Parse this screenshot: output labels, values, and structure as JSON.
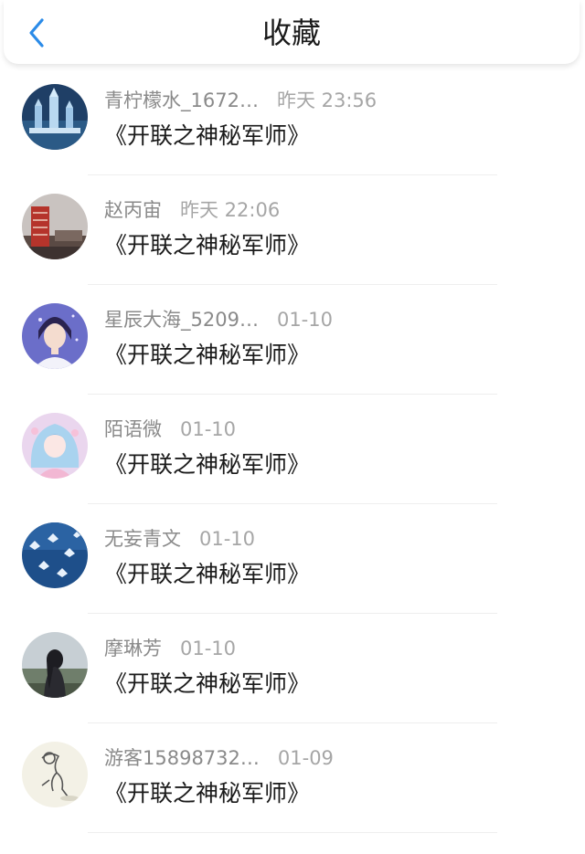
{
  "header": {
    "title": "收藏"
  },
  "items": [
    {
      "user": "青柠檬水_1672…",
      "time": "昨天 23:56",
      "book": "《开联之神秘军师》",
      "avatar": "castle-night-avatar"
    },
    {
      "user": "赵丙宙",
      "time": "昨天 22:06",
      "book": "《开联之神秘军师》",
      "avatar": "tower-avatar"
    },
    {
      "user": "星辰大海_5209…",
      "time": "01-10",
      "book": "《开联之神秘军师》",
      "avatar": "anime-boy-avatar"
    },
    {
      "user": "陌语微",
      "time": "01-10",
      "book": "《开联之神秘军师》",
      "avatar": "anime-girl-avatar"
    },
    {
      "user": "无妄青文",
      "time": "01-10",
      "book": "《开联之神秘军师》",
      "avatar": "butterflies-avatar"
    },
    {
      "user": "摩琳芳",
      "time": "01-10",
      "book": "《开联之神秘军师》",
      "avatar": "girl-silhouette-avatar"
    },
    {
      "user": "游客15898732…",
      "time": "01-09",
      "book": "《开联之神秘军师》",
      "avatar": "sketch-avatar"
    }
  ],
  "colors": {
    "accent": "#2b8be8",
    "meta": "#8a8a8a",
    "title": "#1a1a1a"
  }
}
